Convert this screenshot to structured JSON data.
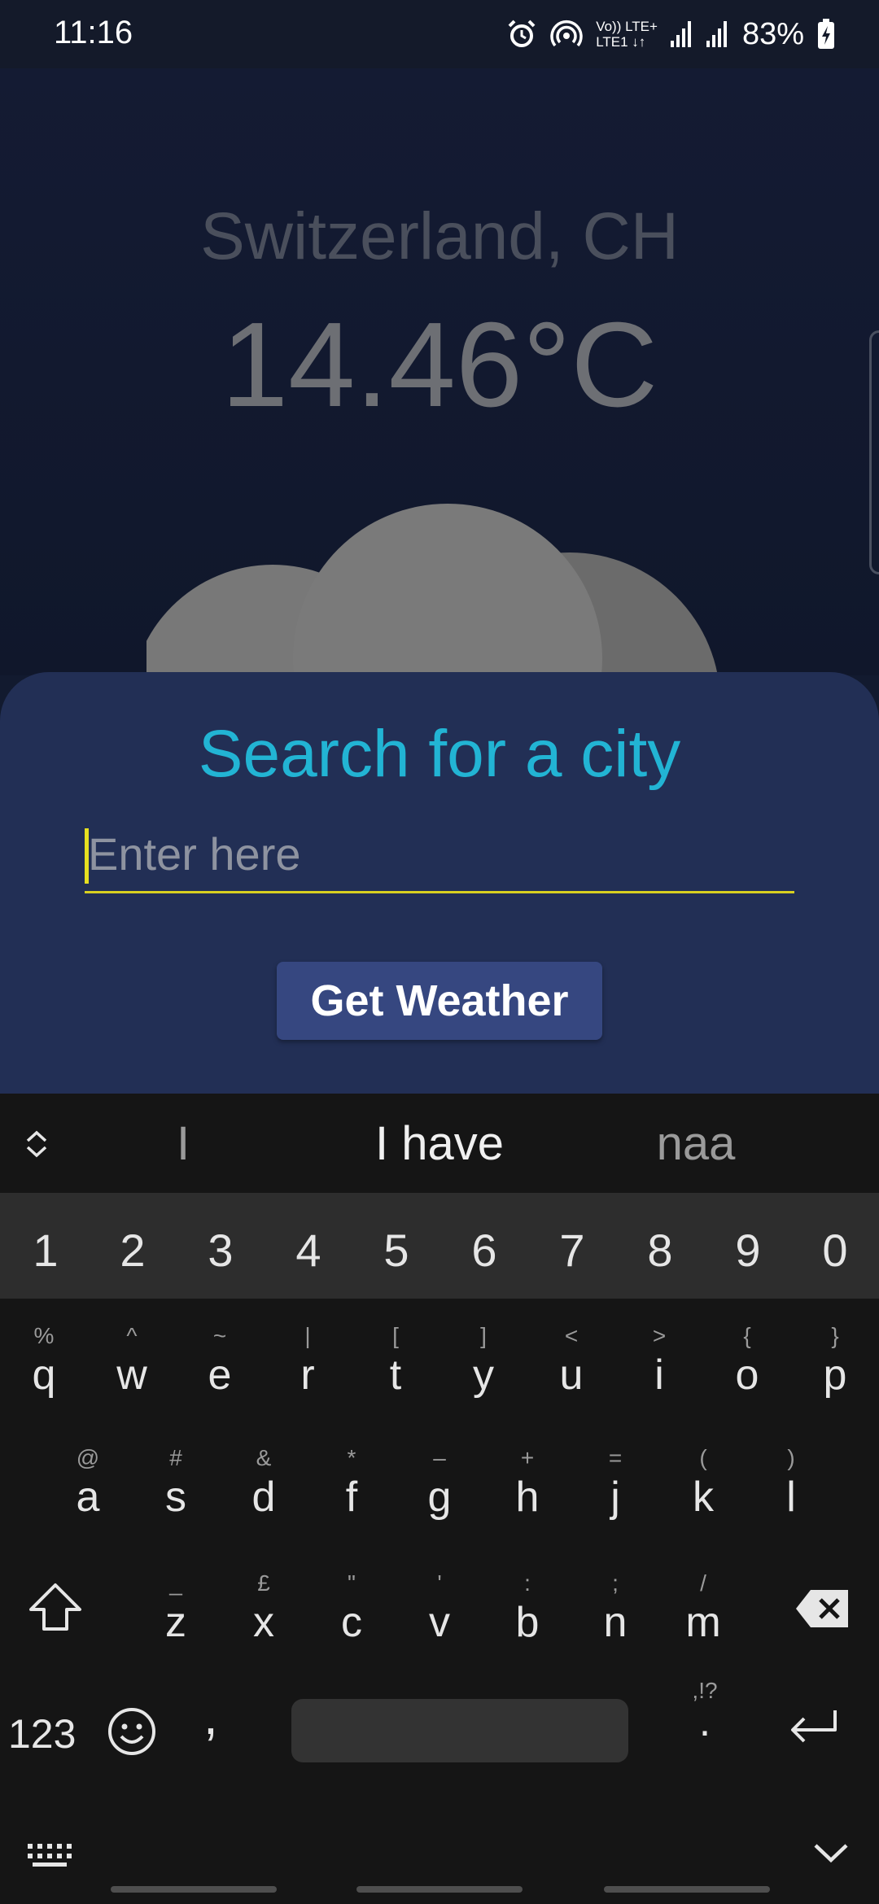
{
  "status_bar": {
    "time": "11:16",
    "network_line1": "Vo)) LTE+",
    "network_line2": "LTE1 ↓↑",
    "battery": "83%",
    "icons": [
      "alarm-icon",
      "hotspot-icon",
      "signal-icon",
      "signal-icon",
      "battery-charging-icon"
    ]
  },
  "weather": {
    "location": "Switzerland, CH",
    "temperature": "14.46°C",
    "condition_icon": "cloud-icon"
  },
  "search_sheet": {
    "title": "Search for a city",
    "input_placeholder": "Enter here",
    "input_value": "",
    "button_label": "Get Weather",
    "colors": {
      "title": "#22b4d4",
      "underline": "#d8d020",
      "button": "#364780",
      "sheet": "#222f55"
    }
  },
  "keyboard": {
    "suggestions": [
      "I",
      "I have",
      "naa"
    ],
    "number_row": [
      "1",
      "2",
      "3",
      "4",
      "5",
      "6",
      "7",
      "8",
      "9",
      "0"
    ],
    "row1": [
      {
        "key": "q",
        "hint": "%"
      },
      {
        "key": "w",
        "hint": "^"
      },
      {
        "key": "e",
        "hint": "~"
      },
      {
        "key": "r",
        "hint": "|"
      },
      {
        "key": "t",
        "hint": "["
      },
      {
        "key": "y",
        "hint": "]"
      },
      {
        "key": "u",
        "hint": "<"
      },
      {
        "key": "i",
        "hint": ">"
      },
      {
        "key": "o",
        "hint": "{"
      },
      {
        "key": "p",
        "hint": "}"
      }
    ],
    "row2": [
      {
        "key": "a",
        "hint": "@"
      },
      {
        "key": "s",
        "hint": "#"
      },
      {
        "key": "d",
        "hint": "&"
      },
      {
        "key": "f",
        "hint": "*"
      },
      {
        "key": "g",
        "hint": "–"
      },
      {
        "key": "h",
        "hint": "+"
      },
      {
        "key": "j",
        "hint": "="
      },
      {
        "key": "k",
        "hint": "("
      },
      {
        "key": "l",
        "hint": ")"
      }
    ],
    "row3": [
      {
        "key": "z",
        "hint": "_"
      },
      {
        "key": "x",
        "hint": "£"
      },
      {
        "key": "c",
        "hint": "\""
      },
      {
        "key": "v",
        "hint": "'"
      },
      {
        "key": "b",
        "hint": ":"
      },
      {
        "key": "n",
        "hint": ";"
      },
      {
        "key": "m",
        "hint": "/"
      }
    ],
    "symbols_key": "123",
    "comma_key": ",",
    "period_key": ".",
    "period_hint": ",!?"
  }
}
